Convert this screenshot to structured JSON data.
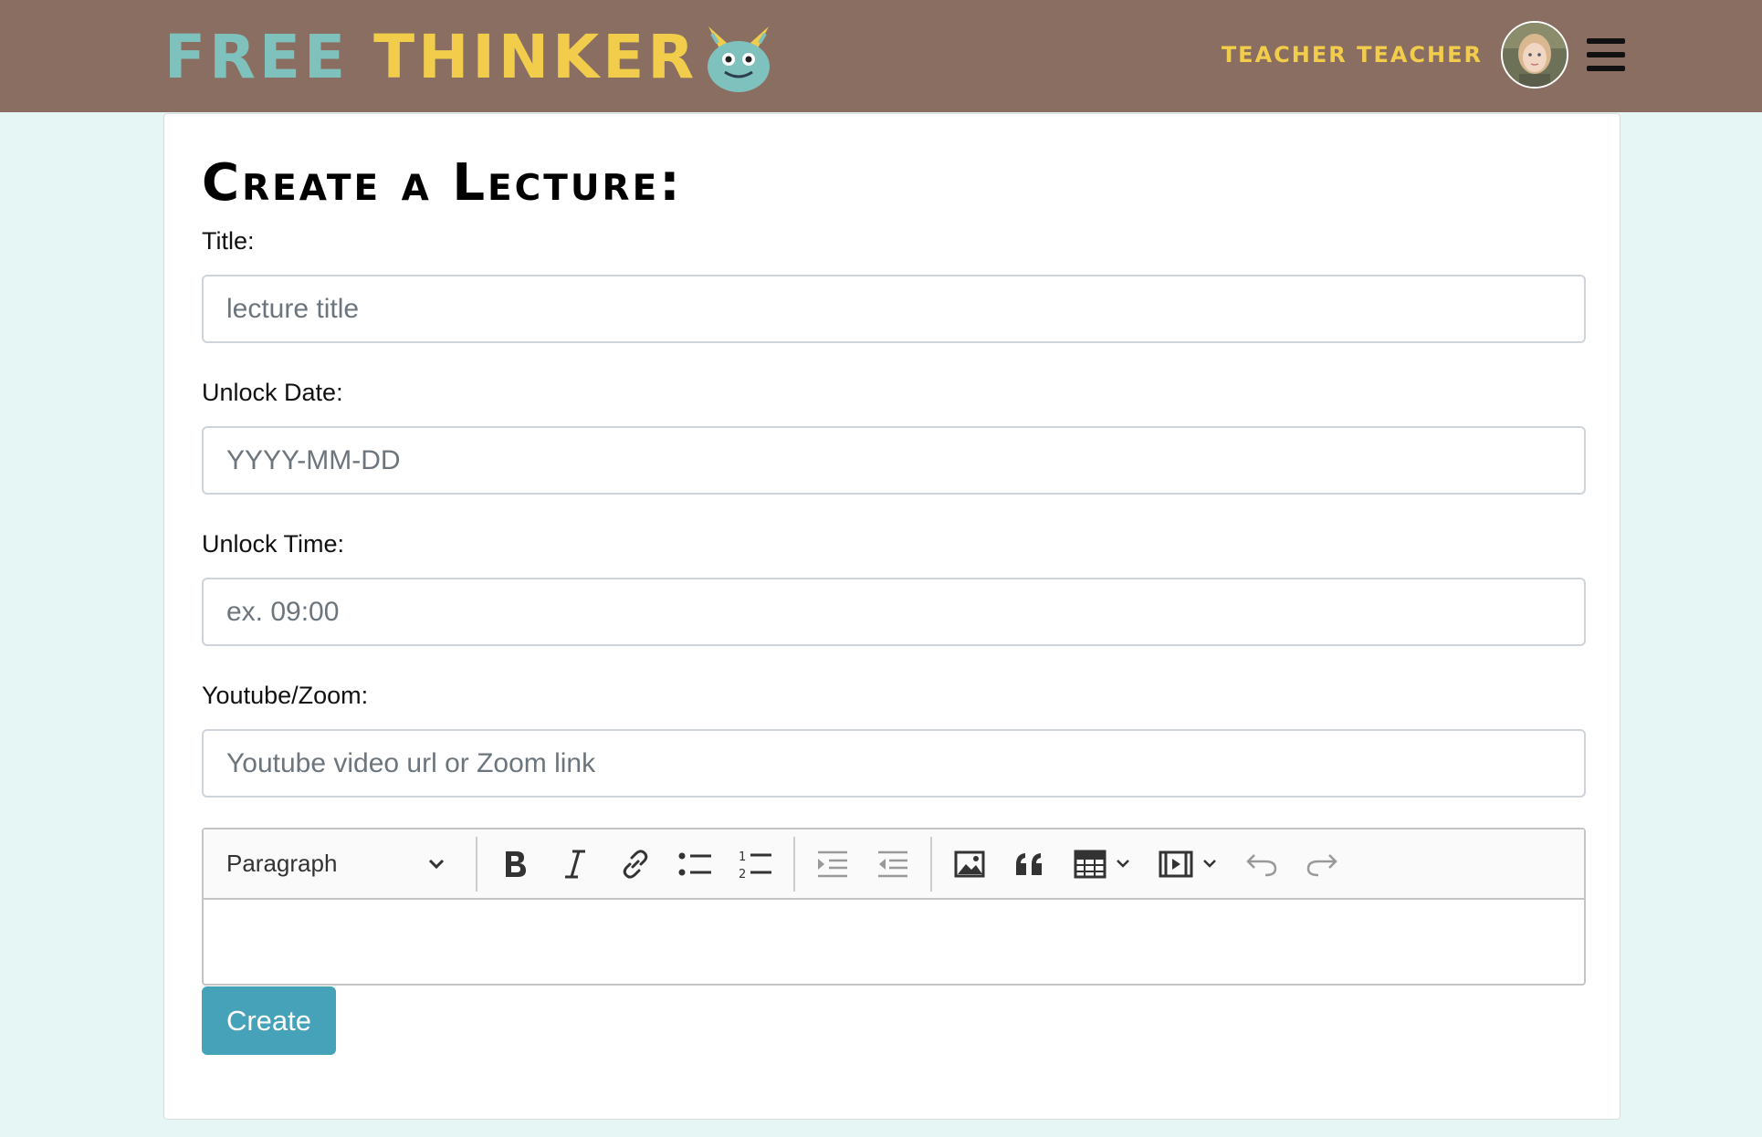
{
  "header": {
    "brand_word1": "FREE",
    "brand_word2": "THINKER",
    "user_name": "Teacher Teacher"
  },
  "form": {
    "title": "Create a Lecture:",
    "fields": [
      {
        "label": "Title:",
        "placeholder": "lecture title",
        "value": ""
      },
      {
        "label": "Unlock Date:",
        "placeholder": "YYYY-MM-DD",
        "value": ""
      },
      {
        "label": "Unlock Time:",
        "placeholder": "ex. 09:00",
        "value": ""
      },
      {
        "label": "Youtube/Zoom:",
        "placeholder": "Youtube video url or Zoom link",
        "value": ""
      }
    ],
    "editor": {
      "heading_select": "Paragraph",
      "toolbar_icons": [
        "bold-icon",
        "italic-icon",
        "link-icon",
        "bulleted-list-icon",
        "numbered-list-icon",
        "indent-icon",
        "outdent-icon",
        "image-icon",
        "quote-icon",
        "table-icon",
        "media-icon",
        "undo-icon",
        "redo-icon"
      ],
      "content": ""
    },
    "submit_label": "Create"
  },
  "colors": {
    "navbar": "#8a6e61",
    "background": "#e6f6f5",
    "brand_teal": "#7fc2bd",
    "brand_yellow": "#f2cd4c",
    "button": "#46a2b8"
  }
}
